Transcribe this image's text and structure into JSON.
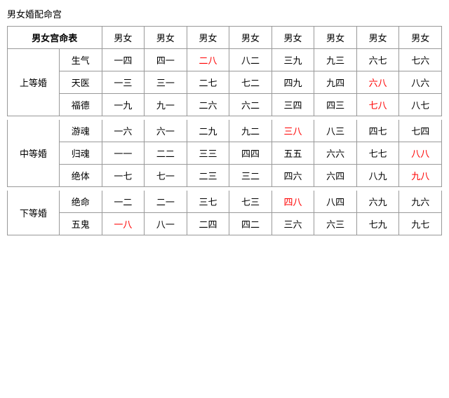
{
  "title": "男女婚配命宫",
  "table": {
    "corner_label": "男女宫命表",
    "col_headers": [
      "男女",
      "男女",
      "男女",
      "男女",
      "男女",
      "男女",
      "男女",
      "男女"
    ],
    "sections": [
      {
        "section_label": "上等婚",
        "rows": [
          {
            "sub_label": "生气",
            "cells": [
              {
                "text": "一四",
                "red": false
              },
              {
                "text": "四一",
                "red": false
              },
              {
                "text": "二八",
                "red": true
              },
              {
                "text": "八二",
                "red": false
              },
              {
                "text": "三九",
                "red": false
              },
              {
                "text": "九三",
                "red": false
              },
              {
                "text": "六七",
                "red": false
              },
              {
                "text": "七六",
                "red": false
              }
            ]
          },
          {
            "sub_label": "天医",
            "cells": [
              {
                "text": "一三",
                "red": false
              },
              {
                "text": "三一",
                "red": false
              },
              {
                "text": "二七",
                "red": false
              },
              {
                "text": "七二",
                "red": false
              },
              {
                "text": "四九",
                "red": false
              },
              {
                "text": "九四",
                "red": false
              },
              {
                "text": "六八",
                "red": true
              },
              {
                "text": "八六",
                "red": false
              }
            ]
          },
          {
            "sub_label": "福德",
            "cells": [
              {
                "text": "一九",
                "red": false
              },
              {
                "text": "九一",
                "red": false
              },
              {
                "text": "二六",
                "red": false
              },
              {
                "text": "六二",
                "red": false
              },
              {
                "text": "三四",
                "red": false
              },
              {
                "text": "四三",
                "red": false
              },
              {
                "text": "七八",
                "red": true
              },
              {
                "text": "八七",
                "red": false
              }
            ]
          }
        ]
      },
      {
        "section_label": "中等婚",
        "rows": [
          {
            "sub_label": "游魂",
            "cells": [
              {
                "text": "一六",
                "red": false
              },
              {
                "text": "六一",
                "red": false
              },
              {
                "text": "二九",
                "red": false
              },
              {
                "text": "九二",
                "red": false
              },
              {
                "text": "三八",
                "red": true
              },
              {
                "text": "八三",
                "red": false
              },
              {
                "text": "四七",
                "red": false
              },
              {
                "text": "七四",
                "red": false
              }
            ]
          },
          {
            "sub_label": "归魂",
            "cells": [
              {
                "text": "一一",
                "red": false
              },
              {
                "text": "二二",
                "red": false
              },
              {
                "text": "三三",
                "red": false
              },
              {
                "text": "四四",
                "red": false
              },
              {
                "text": "五五",
                "red": false
              },
              {
                "text": "六六",
                "red": false
              },
              {
                "text": "七七",
                "red": false
              },
              {
                "text": "八八",
                "red": true
              }
            ]
          },
          {
            "sub_label": "绝体",
            "cells": [
              {
                "text": "一七",
                "red": false
              },
              {
                "text": "七一",
                "red": false
              },
              {
                "text": "二三",
                "red": false
              },
              {
                "text": "三二",
                "red": false
              },
              {
                "text": "四六",
                "red": false
              },
              {
                "text": "六四",
                "red": false
              },
              {
                "text": "八九",
                "red": false
              },
              {
                "text": "九八",
                "red": true
              }
            ]
          }
        ]
      },
      {
        "section_label": "下等婚",
        "rows": [
          {
            "sub_label": "绝命",
            "cells": [
              {
                "text": "一二",
                "red": false
              },
              {
                "text": "二一",
                "red": false
              },
              {
                "text": "三七",
                "red": false
              },
              {
                "text": "七三",
                "red": false
              },
              {
                "text": "四八",
                "red": true
              },
              {
                "text": "八四",
                "red": false
              },
              {
                "text": "六九",
                "red": false
              },
              {
                "text": "九六",
                "red": false
              }
            ]
          },
          {
            "sub_label": "五鬼",
            "cells": [
              {
                "text": "一八",
                "red": true
              },
              {
                "text": "八一",
                "red": false
              },
              {
                "text": "二四",
                "red": false
              },
              {
                "text": "四二",
                "red": false
              },
              {
                "text": "三六",
                "red": false
              },
              {
                "text": "六三",
                "red": false
              },
              {
                "text": "七九",
                "red": false
              },
              {
                "text": "九七",
                "red": false
              }
            ]
          }
        ]
      }
    ]
  }
}
